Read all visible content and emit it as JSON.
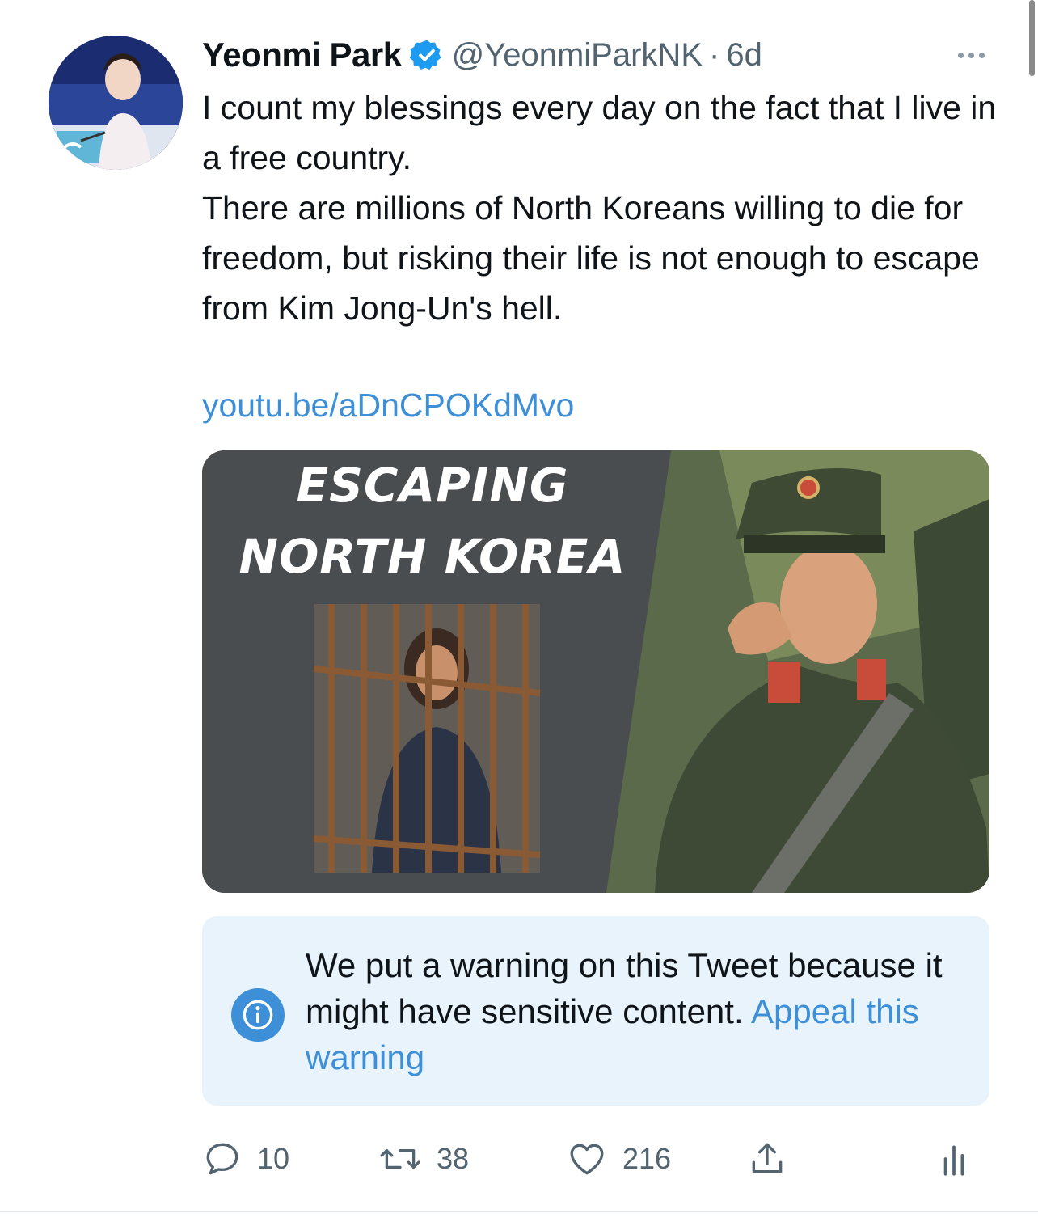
{
  "tweet": {
    "author_name": "Yeonmi Park",
    "handle": "@YeonmiParkNK",
    "separator": "·",
    "timestamp": "6d",
    "text_lines": [
      "I count my blessings every day on the fact that I live in a free country.",
      "There are millions of North Koreans willing to die for freedom, but risking their life is not enough to escape from Kim Jong-Un's hell."
    ],
    "link": "youtu.be/aDnCPOKdMvo",
    "media": {
      "title_line1": "ESCAPING",
      "title_line2": "NORTH KOREA"
    },
    "warning": {
      "text": "We put a warning on this Tweet because it might have sensitive content.",
      "appeal_link": "Appeal this warning"
    },
    "actions": {
      "replies": "10",
      "retweets": "38",
      "likes": "216"
    }
  },
  "icons": {
    "verified": "verified-badge-icon",
    "more": "more-options-icon",
    "info": "info-icon",
    "reply": "reply-icon",
    "retweet": "retweet-icon",
    "like": "heart-icon",
    "share": "share-icon",
    "stats": "analytics-icon"
  },
  "colors": {
    "accent": "#3d8fd8",
    "muted": "#536471",
    "warning_bg": "#e8f3fb"
  }
}
